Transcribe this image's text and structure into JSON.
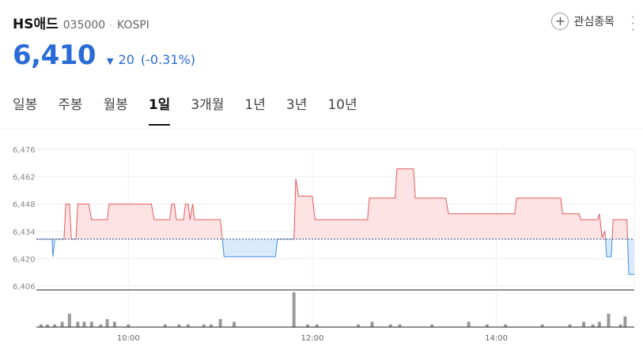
{
  "header": {
    "name": "HS애드",
    "code": "035000",
    "market": "KOSPI",
    "favorite_label": "관심종목"
  },
  "price": {
    "current": "6,410",
    "change": "20",
    "change_pct": "(-0.31%)",
    "direction": "down",
    "color": "#2a6bd6"
  },
  "tabs": [
    "일봉",
    "주봉",
    "월봉",
    "1일",
    "3개월",
    "1년",
    "3년",
    "10년"
  ],
  "active_tab": "1일",
  "icons": {
    "favorite": "plus-circle-icon",
    "more": "vertical-dots-icon",
    "direction": "triangle-down-icon"
  },
  "chart_data": {
    "type": "area",
    "baseline": 6430,
    "ylim": [
      6406,
      6476
    ],
    "yticks": [
      "6,476",
      "6,462",
      "6,448",
      "6,434",
      "6,420",
      "6,406"
    ],
    "xticks": [
      "10:00",
      "12:00",
      "14:00"
    ],
    "xlim": [
      9.0,
      15.5
    ],
    "colors": {
      "above": "#e5595b",
      "above_fill": "#fde3e3",
      "below": "#3a8fe0",
      "below_fill": "#dbeafb"
    },
    "price_series": [
      [
        9.0,
        6430
      ],
      [
        9.17,
        6430
      ],
      [
        9.18,
        6421
      ],
      [
        9.2,
        6430
      ],
      [
        9.3,
        6430
      ],
      [
        9.32,
        6448
      ],
      [
        9.36,
        6448
      ],
      [
        9.38,
        6430
      ],
      [
        9.43,
        6430
      ],
      [
        9.45,
        6448
      ],
      [
        9.57,
        6448
      ],
      [
        9.6,
        6440
      ],
      [
        9.77,
        6440
      ],
      [
        9.79,
        6448
      ],
      [
        10.1,
        6448
      ],
      [
        10.25,
        6448
      ],
      [
        10.28,
        6440
      ],
      [
        10.45,
        6440
      ],
      [
        10.47,
        6448
      ],
      [
        10.5,
        6448
      ],
      [
        10.52,
        6440
      ],
      [
        10.6,
        6440
      ],
      [
        10.62,
        6448
      ],
      [
        10.65,
        6448
      ],
      [
        10.67,
        6440
      ],
      [
        10.7,
        6448
      ],
      [
        10.72,
        6440
      ],
      [
        11.0,
        6440
      ],
      [
        11.02,
        6431
      ],
      [
        11.04,
        6421
      ],
      [
        11.6,
        6421
      ],
      [
        11.62,
        6430
      ],
      [
        11.8,
        6430
      ],
      [
        11.82,
        6461
      ],
      [
        11.85,
        6452
      ],
      [
        12.0,
        6452
      ],
      [
        12.03,
        6440
      ],
      [
        12.6,
        6440
      ],
      [
        12.62,
        6451
      ],
      [
        12.9,
        6451
      ],
      [
        12.92,
        6466
      ],
      [
        13.1,
        6466
      ],
      [
        13.12,
        6451
      ],
      [
        13.45,
        6451
      ],
      [
        13.48,
        6443
      ],
      [
        14.2,
        6443
      ],
      [
        14.22,
        6451
      ],
      [
        14.7,
        6451
      ],
      [
        14.72,
        6443
      ],
      [
        14.9,
        6443
      ],
      [
        14.92,
        6440
      ],
      [
        15.1,
        6440
      ],
      [
        15.12,
        6443
      ],
      [
        15.15,
        6431
      ],
      [
        15.18,
        6434
      ],
      [
        15.2,
        6421
      ],
      [
        15.25,
        6421
      ],
      [
        15.27,
        6440
      ],
      [
        15.42,
        6440
      ],
      [
        15.44,
        6412
      ],
      [
        15.5,
        6412
      ]
    ],
    "volume_series": [
      [
        9.05,
        1
      ],
      [
        9.12,
        1
      ],
      [
        9.2,
        1
      ],
      [
        9.28,
        2
      ],
      [
        9.36,
        5
      ],
      [
        9.45,
        2
      ],
      [
        9.52,
        2
      ],
      [
        9.6,
        2
      ],
      [
        9.7,
        1
      ],
      [
        9.77,
        3
      ],
      [
        9.85,
        2
      ],
      [
        10.0,
        1
      ],
      [
        10.4,
        1
      ],
      [
        10.55,
        1
      ],
      [
        10.65,
        1
      ],
      [
        10.82,
        1
      ],
      [
        10.9,
        1
      ],
      [
        11.0,
        3
      ],
      [
        11.15,
        2
      ],
      [
        11.8,
        13
      ],
      [
        11.95,
        1
      ],
      [
        12.05,
        1
      ],
      [
        12.5,
        1
      ],
      [
        12.65,
        2
      ],
      [
        12.85,
        1
      ],
      [
        12.95,
        1
      ],
      [
        13.3,
        1
      ],
      [
        13.7,
        2
      ],
      [
        13.9,
        1
      ],
      [
        14.1,
        1
      ],
      [
        14.5,
        1
      ],
      [
        14.8,
        1
      ],
      [
        14.95,
        2
      ],
      [
        15.05,
        1
      ],
      [
        15.12,
        2
      ],
      [
        15.22,
        5
      ],
      [
        15.35,
        1
      ],
      [
        15.4,
        4
      ]
    ],
    "volume_max": 13
  }
}
